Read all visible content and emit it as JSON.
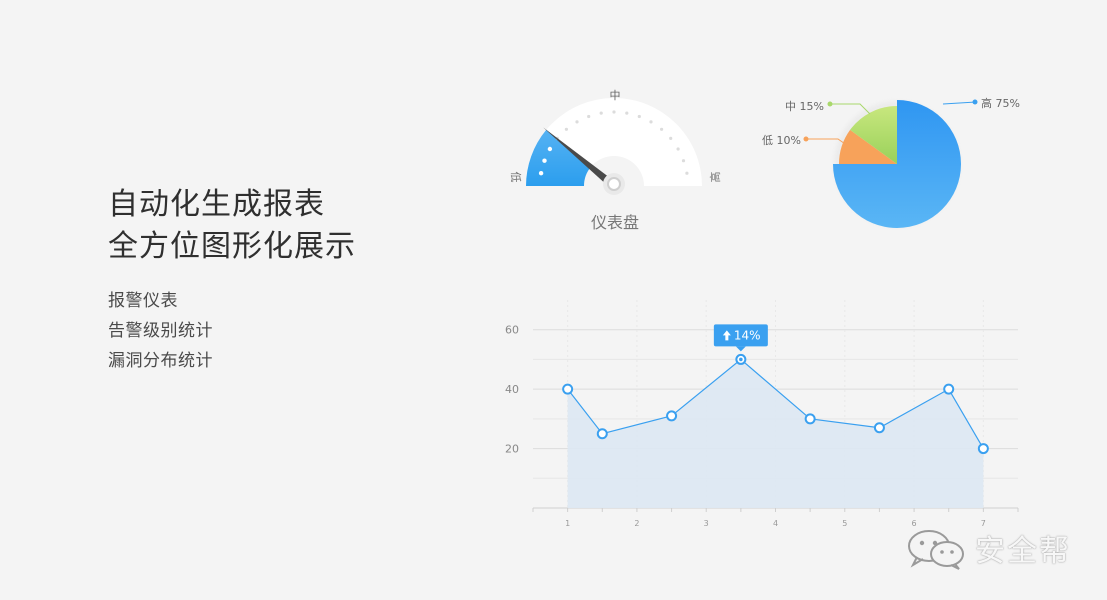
{
  "headline": {
    "line1": "自动化生成报表",
    "line2": "全方位图形化展示"
  },
  "features": [
    "报警仪表",
    "告警级别统计",
    "漏洞分布统计"
  ],
  "gauge": {
    "title": "仪表盘",
    "label_low": "低",
    "label_mid": "中",
    "label_high": "高",
    "value": 0.22,
    "colors": {
      "fill_top": "#4aa8f0",
      "fill_bottom": "#2fa0ee",
      "track": "#ffffff",
      "needle": "#4a4a4a"
    }
  },
  "chart_data": [
    {
      "type": "pie",
      "slices": [
        {
          "label": "高",
          "value": 75,
          "display": "高 75%",
          "color": "#3aa0f0"
        },
        {
          "label": "低",
          "value": 10,
          "display": "低 10%",
          "color": "#f7a25a"
        },
        {
          "label": "中",
          "value": 15,
          "display": "中 15%",
          "color": "#a9d86b"
        }
      ]
    },
    {
      "type": "area",
      "x_ticks": [
        "1",
        "2",
        "3",
        "4",
        "5",
        "6",
        "7"
      ],
      "points": [
        {
          "x": 1,
          "y": 40
        },
        {
          "x": 1.5,
          "y": 25
        },
        {
          "x": 2.5,
          "y": 31
        },
        {
          "x": 3.5,
          "y": 50
        },
        {
          "x": 4.5,
          "y": 30
        },
        {
          "x": 5.5,
          "y": 27
        },
        {
          "x": 6.5,
          "y": 40
        },
        {
          "x": 7,
          "y": 20
        }
      ],
      "ylim": [
        0,
        70
      ],
      "y_ticks": [
        20,
        40,
        60
      ],
      "y_tick_labels": [
        "20",
        "40",
        "60"
      ],
      "xlim": [
        0.5,
        7.5
      ],
      "grid": true,
      "tooltip": {
        "point_index": 3,
        "label": "14%"
      },
      "colors": {
        "line": "#3aa0f0",
        "area": "#dde8f3"
      }
    }
  ],
  "watermark": {
    "text": "安全帮"
  }
}
